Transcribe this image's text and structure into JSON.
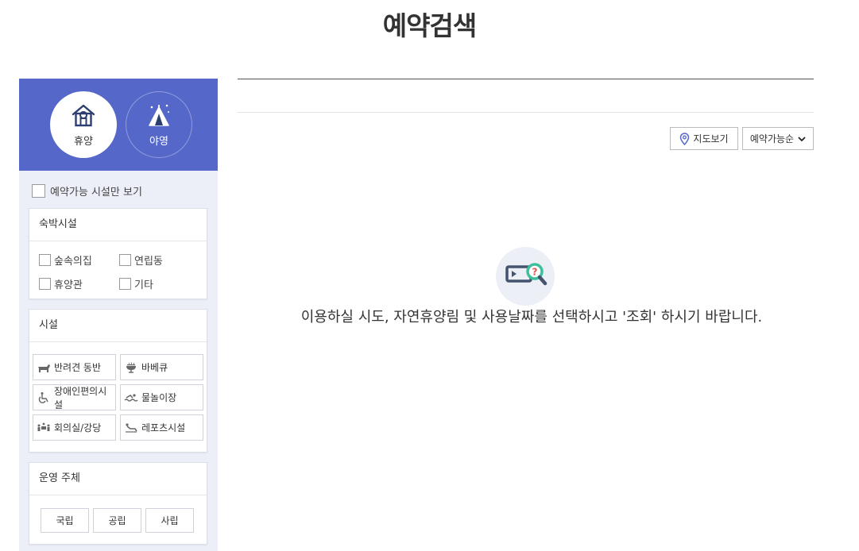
{
  "page": {
    "title": "예약검색"
  },
  "sidebar": {
    "modes": [
      {
        "label": "휴양",
        "icon": "house-icon",
        "active": true
      },
      {
        "label": "야영",
        "icon": "tent-icon",
        "active": false
      }
    ],
    "available_only_label": "예약가능 시설만 보기",
    "lodging": {
      "title": "숙박시설",
      "options": [
        "숲속의집",
        "연립동",
        "휴양관",
        "기타"
      ]
    },
    "facilities": {
      "title": "시설",
      "options": [
        {
          "label": "반려견 동반",
          "icon": "dog-icon"
        },
        {
          "label": "바베큐",
          "icon": "grill-icon"
        },
        {
          "label": "장애인편의시설",
          "icon": "wheelchair-icon"
        },
        {
          "label": "물놀이장",
          "icon": "swimming-icon"
        },
        {
          "label": "회의실/강당",
          "icon": "meeting-icon"
        },
        {
          "label": "레포츠시설",
          "icon": "sports-icon"
        }
      ]
    },
    "operator": {
      "title": "운영 주체",
      "options": [
        "국립",
        "공립",
        "사립"
      ]
    }
  },
  "toolbar": {
    "map_label": "지도보기",
    "sort_value": "예약가능순"
  },
  "main": {
    "empty_message": "이용하실 시도, 자연휴양림 및 사용날짜를 선택하시고 '조회' 하시기 바랍니다."
  },
  "colors": {
    "accent": "#5567c9",
    "sidebar_bg": "#eceef8",
    "icon_teal": "#3dbf9a",
    "icon_red": "#e05454"
  }
}
